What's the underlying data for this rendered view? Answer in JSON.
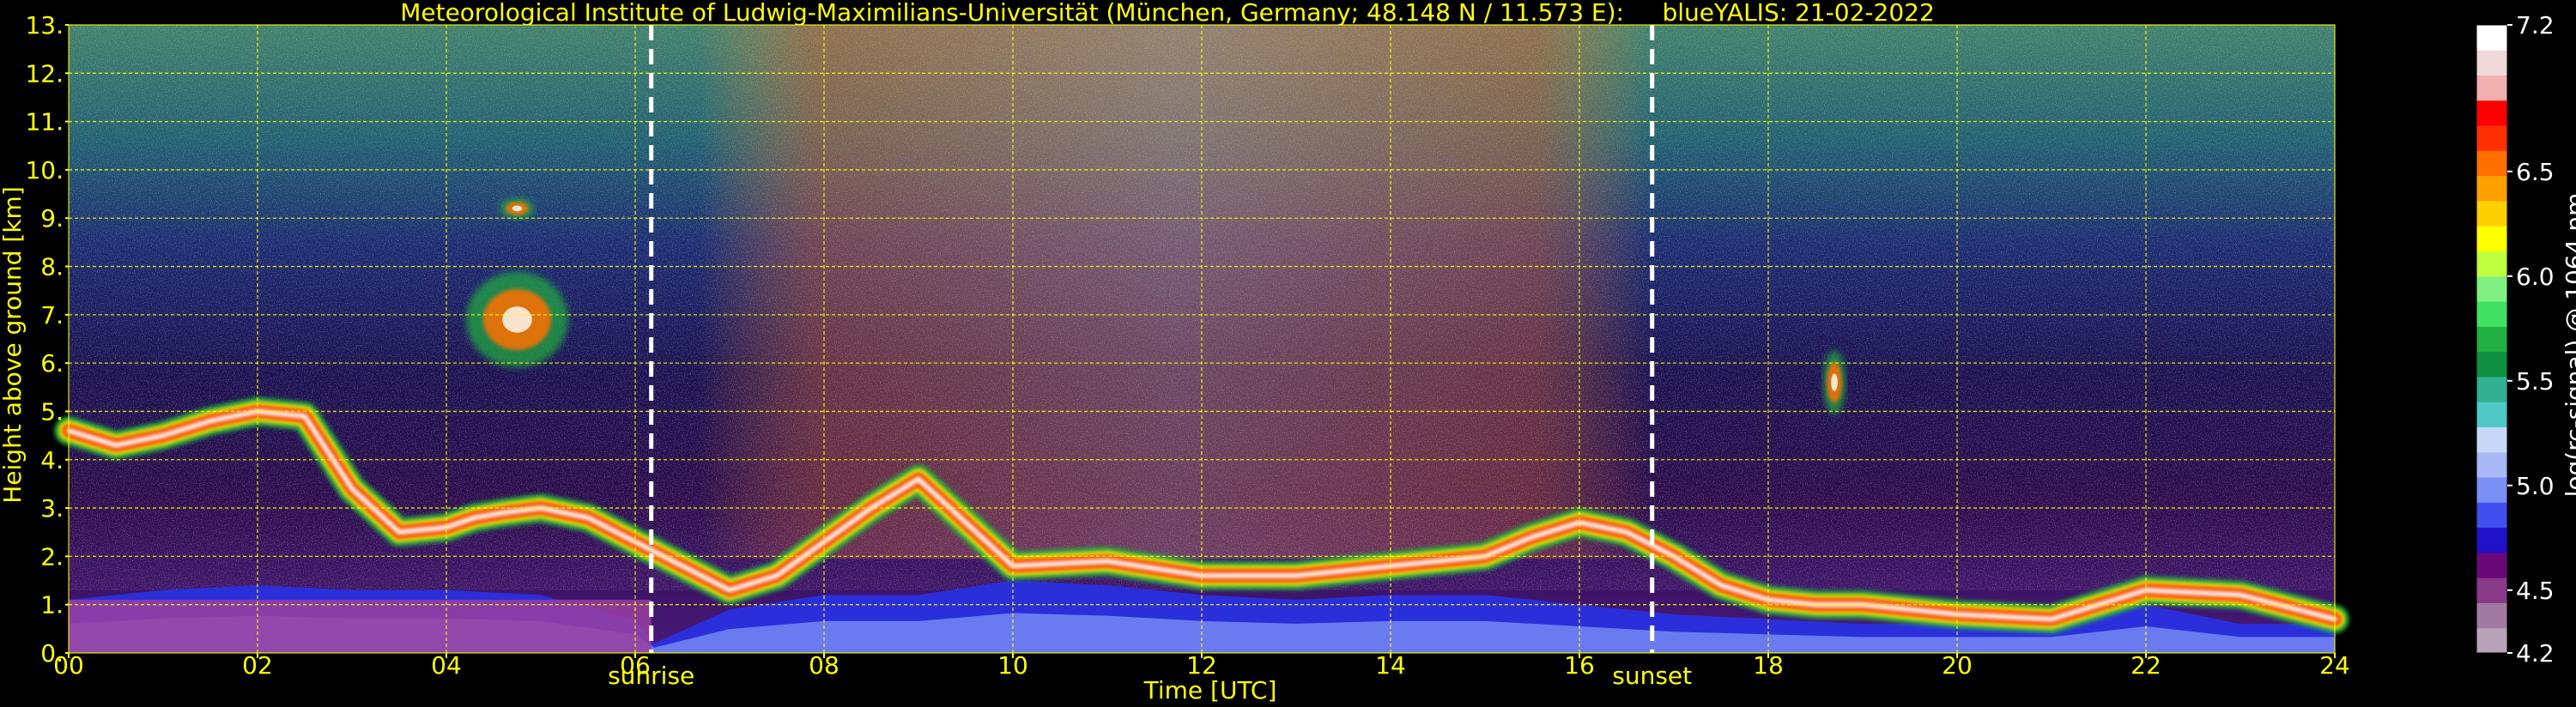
{
  "chart_data": {
    "type": "heatmap",
    "title": "Meteorological Institute of Ludwig-Maximilians-Universität (München, Germany; 48.148 N / 11.573 E):     blueYALIS: 21-02-2022",
    "xlabel": "Time [UTC]",
    "ylabel": "Height above ground [km]",
    "colorbar_label": "log(rc-signal) @ 1064 nm",
    "x_ticks": [
      "00",
      "02",
      "04",
      "06",
      "08",
      "10",
      "12",
      "14",
      "16",
      "18",
      "20",
      "22",
      "24"
    ],
    "y_ticks": [
      "0.",
      "1.",
      "2.",
      "3.",
      "4.",
      "5.",
      "6.",
      "7.",
      "8.",
      "9.",
      "10.",
      "11.",
      "12.",
      "13."
    ],
    "xlim": [
      0,
      24
    ],
    "ylim": [
      0,
      13
    ],
    "colorbar_range": [
      4.2,
      7.2
    ],
    "colorbar_ticks": [
      "4.2",
      "4.5",
      "5.0",
      "5.5",
      "6.0",
      "6.5",
      "7.2"
    ],
    "colorbar_tick_values": [
      4.2,
      4.5,
      5.0,
      5.5,
      6.0,
      6.5,
      7.2
    ],
    "grid": true,
    "grid_color": "#ffff00",
    "events": [
      {
        "label": "sunrise",
        "time": 6.17
      },
      {
        "label": "sunset",
        "time": 16.77
      }
    ],
    "colormap": [
      "#b9a3b9",
      "#a07aa0",
      "#883a88",
      "#6a087a",
      "#2010c8",
      "#4050f0",
      "#7a8ff5",
      "#a8b8f5",
      "#c8d8f8",
      "#50c8c8",
      "#30b090",
      "#109040",
      "#20b040",
      "#40e060",
      "#80f080",
      "#c0ff40",
      "#ffff00",
      "#ffd000",
      "#ffa000",
      "#ff7000",
      "#ff3000",
      "#ff0000",
      "#f0b0b0",
      "#f0d8d8",
      "#ffffff"
    ],
    "mixing_layer_height_km": [
      [
        0.0,
        1.1
      ],
      [
        0.5,
        1.2
      ],
      [
        1.0,
        1.3
      ],
      [
        2.0,
        1.4
      ],
      [
        3.0,
        1.3
      ],
      [
        4.0,
        1.3
      ],
      [
        5.0,
        1.2
      ],
      [
        6.0,
        0.7
      ],
      [
        6.2,
        0.2
      ],
      [
        7.0,
        0.9
      ],
      [
        8.0,
        1.2
      ],
      [
        9.0,
        1.2
      ],
      [
        10.0,
        1.5
      ],
      [
        11.0,
        1.4
      ],
      [
        12.0,
        1.2
      ],
      [
        13.0,
        1.1
      ],
      [
        14.0,
        1.2
      ],
      [
        15.0,
        1.2
      ],
      [
        16.0,
        1.0
      ],
      [
        17.0,
        0.8
      ],
      [
        18.0,
        0.7
      ],
      [
        19.0,
        0.6
      ],
      [
        20.0,
        0.6
      ],
      [
        21.0,
        0.6
      ],
      [
        22.0,
        1.0
      ],
      [
        23.0,
        0.6
      ],
      [
        24.0,
        0.6
      ]
    ],
    "aerosol_layer_km": [
      [
        0.0,
        4.6
      ],
      [
        0.5,
        4.3
      ],
      [
        1.0,
        4.5
      ],
      [
        1.5,
        4.8
      ],
      [
        2.0,
        5.0
      ],
      [
        2.5,
        4.9
      ],
      [
        2.8,
        4.0
      ],
      [
        3.0,
        3.4
      ],
      [
        3.5,
        2.5
      ],
      [
        4.0,
        2.6
      ],
      [
        4.3,
        2.8
      ],
      [
        4.6,
        2.9
      ],
      [
        5.0,
        3.0
      ],
      [
        5.5,
        2.8
      ],
      [
        6.0,
        2.3
      ],
      [
        7.0,
        1.3
      ],
      [
        7.5,
        1.6
      ],
      [
        8.0,
        2.3
      ],
      [
        8.5,
        3.0
      ],
      [
        9.0,
        3.6
      ],
      [
        9.5,
        2.7
      ],
      [
        10.0,
        1.8
      ],
      [
        11.0,
        1.9
      ],
      [
        12.0,
        1.6
      ],
      [
        13.0,
        1.6
      ],
      [
        14.0,
        1.8
      ],
      [
        15.0,
        2.0
      ],
      [
        15.5,
        2.4
      ],
      [
        16.0,
        2.7
      ],
      [
        16.5,
        2.5
      ],
      [
        17.0,
        2.0
      ],
      [
        17.5,
        1.4
      ],
      [
        18.0,
        1.1
      ],
      [
        18.5,
        1.0
      ],
      [
        19.0,
        1.0
      ],
      [
        20.0,
        0.8
      ],
      [
        21.0,
        0.7
      ],
      [
        22.0,
        1.3
      ],
      [
        23.0,
        1.2
      ],
      [
        24.0,
        0.7
      ]
    ],
    "elevated_layers": [
      {
        "x0": 4.3,
        "x1": 5.2,
        "y0": 6.0,
        "y1": 7.8
      },
      {
        "x0": 4.6,
        "x1": 4.9,
        "y0": 9.0,
        "y1": 9.4
      },
      {
        "x0": 18.6,
        "x1": 18.8,
        "y0": 5.0,
        "y1": 6.2
      }
    ]
  }
}
